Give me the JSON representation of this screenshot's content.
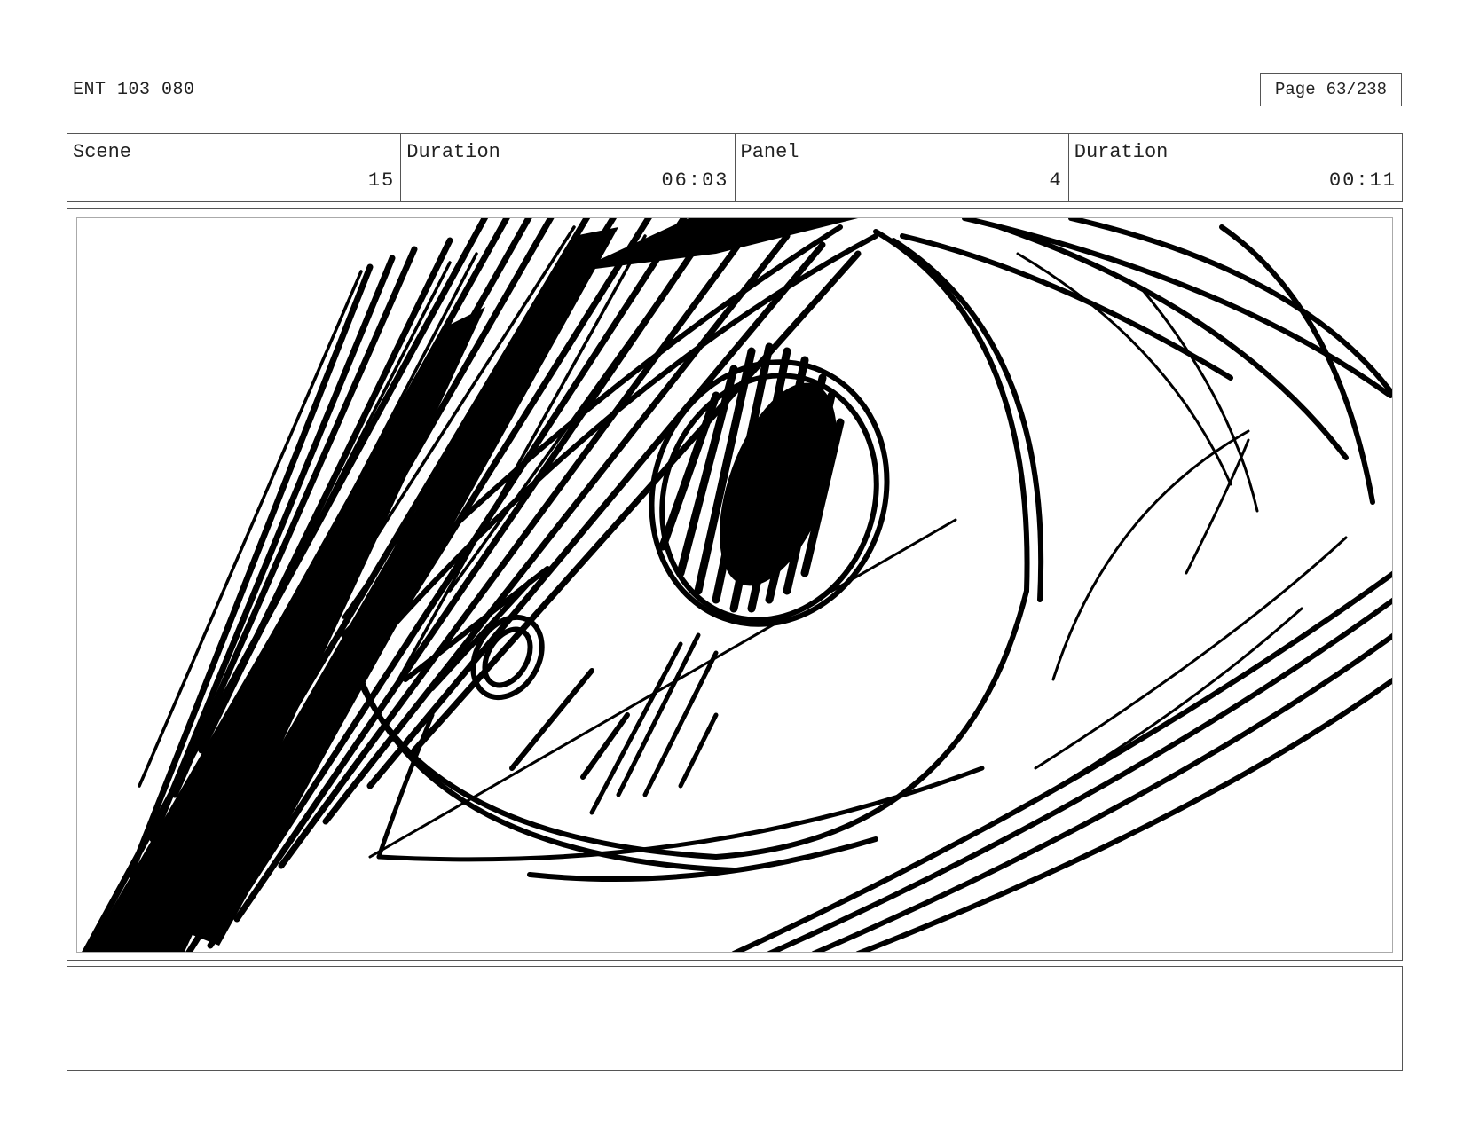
{
  "header": {
    "project_code": "ENT 103 080",
    "page_label": "Page",
    "page_number": "63/238"
  },
  "info": {
    "scene_label": "Scene",
    "scene_value": "15",
    "scene_duration_label": "Duration",
    "scene_duration_value": "06:03",
    "panel_label": "Panel",
    "panel_value": "4",
    "panel_duration_label": "Duration",
    "panel_duration_value": "00:11"
  },
  "panel": {
    "icon": "eye-sketch-drawing",
    "ink_color": "#000000"
  },
  "notes": {
    "text": ""
  }
}
